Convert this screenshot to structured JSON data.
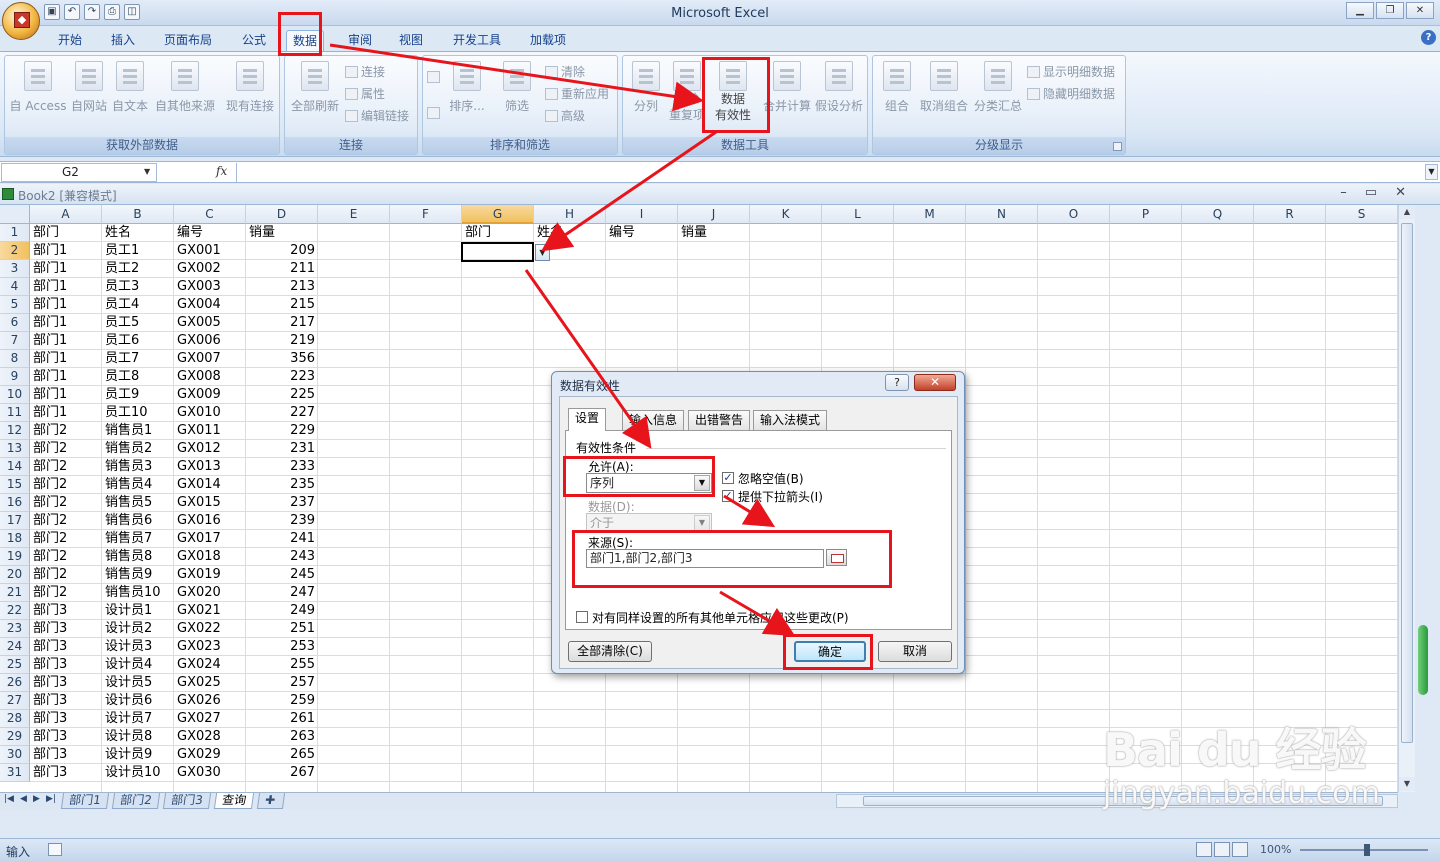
{
  "app": {
    "title": "Microsoft Excel"
  },
  "ribbon_tabs": [
    "开始",
    "插入",
    "页面布局",
    "公式",
    "数据",
    "审阅",
    "视图",
    "开发工具",
    "加载项"
  ],
  "active_tab": "数据",
  "ribbon": {
    "get_external": {
      "label": "获取外部数据",
      "buttons": [
        "自 Access",
        "自网站",
        "自文本",
        "自其他来源",
        "现有连接"
      ]
    },
    "connections": {
      "label": "连接",
      "refresh_all": "全部刷新",
      "items": [
        "连接",
        "属性",
        "编辑链接"
      ]
    },
    "sort_filter": {
      "label": "排序和筛选",
      "sort": "排序...",
      "filter": "筛选",
      "items": [
        "清除",
        "重新应用",
        "高级"
      ]
    },
    "data_tools": {
      "label": "数据工具",
      "buttons": [
        "分列",
        "删除\n重复项",
        "数据\n有效性",
        "合并计算",
        "假设分析"
      ]
    },
    "outline": {
      "label": "分级显示",
      "buttons": [
        "组合",
        "取消组合",
        "分类汇总"
      ],
      "items": [
        "显示明细数据",
        "隐藏明细数据"
      ]
    }
  },
  "formula_bar": {
    "name_box": "G2",
    "fx": "fx",
    "value": ""
  },
  "workbook": {
    "title": "Book2  [兼容模式]"
  },
  "columns": [
    "A",
    "B",
    "C",
    "D",
    "E",
    "F",
    "G",
    "H",
    "I",
    "J",
    "K",
    "L",
    "M",
    "N",
    "O",
    "P",
    "Q",
    "R",
    "S"
  ],
  "header_row": [
    "部门",
    "姓名",
    "编号",
    "销量"
  ],
  "query_headers": [
    "部门",
    "姓名",
    "编号",
    "销量"
  ],
  "rows": [
    [
      "部门1",
      "员工1",
      "GX001",
      "209"
    ],
    [
      "部门1",
      "员工2",
      "GX002",
      "211"
    ],
    [
      "部门1",
      "员工3",
      "GX003",
      "213"
    ],
    [
      "部门1",
      "员工4",
      "GX004",
      "215"
    ],
    [
      "部门1",
      "员工5",
      "GX005",
      "217"
    ],
    [
      "部门1",
      "员工6",
      "GX006",
      "219"
    ],
    [
      "部门1",
      "员工7",
      "GX007",
      "356"
    ],
    [
      "部门1",
      "员工8",
      "GX008",
      "223"
    ],
    [
      "部门1",
      "员工9",
      "GX009",
      "225"
    ],
    [
      "部门1",
      "员工10",
      "GX010",
      "227"
    ],
    [
      "部门2",
      "销售员1",
      "GX011",
      "229"
    ],
    [
      "部门2",
      "销售员2",
      "GX012",
      "231"
    ],
    [
      "部门2",
      "销售员3",
      "GX013",
      "233"
    ],
    [
      "部门2",
      "销售员4",
      "GX014",
      "235"
    ],
    [
      "部门2",
      "销售员5",
      "GX015",
      "237"
    ],
    [
      "部门2",
      "销售员6",
      "GX016",
      "239"
    ],
    [
      "部门2",
      "销售员7",
      "GX017",
      "241"
    ],
    [
      "部门2",
      "销售员8",
      "GX018",
      "243"
    ],
    [
      "部门2",
      "销售员9",
      "GX019",
      "245"
    ],
    [
      "部门2",
      "销售员10",
      "GX020",
      "247"
    ],
    [
      "部门3",
      "设计员1",
      "GX021",
      "249"
    ],
    [
      "部门3",
      "设计员2",
      "GX022",
      "251"
    ],
    [
      "部门3",
      "设计员3",
      "GX023",
      "253"
    ],
    [
      "部门3",
      "设计员4",
      "GX024",
      "255"
    ],
    [
      "部门3",
      "设计员5",
      "GX025",
      "257"
    ],
    [
      "部门3",
      "设计员6",
      "GX026",
      "259"
    ],
    [
      "部门3",
      "设计员7",
      "GX027",
      "261"
    ],
    [
      "部门3",
      "设计员8",
      "GX028",
      "263"
    ],
    [
      "部门3",
      "设计员9",
      "GX029",
      "265"
    ],
    [
      "部门3",
      "设计员10",
      "GX030",
      "267"
    ]
  ],
  "sheet_tabs": [
    "部门1",
    "部门2",
    "部门3",
    "查询"
  ],
  "active_sheet": "查询",
  "status": {
    "mode": "输入",
    "zoom": "100%"
  },
  "dialog": {
    "title": "数据有效性",
    "help": "?",
    "close": "✕",
    "tabs": [
      "设置",
      "输入信息",
      "出错警告",
      "输入法模式"
    ],
    "section": "有效性条件",
    "allow_label": "允许(A):",
    "allow_value": "序列",
    "ignore_blank": "忽略空值(B)",
    "dropdown": "提供下拉箭头(I)",
    "data_label": "数据(D):",
    "data_value": "介于",
    "source_label": "来源(S):",
    "source_value": "部门1,部门2,部门3",
    "apply_all": "对有同样设置的所有其他单元格应用这些更改(P)",
    "clear_all": "全部清除(C)",
    "ok": "确定",
    "cancel": "取消"
  },
  "watermark": {
    "logo": "Bai du 经验",
    "url": "jingyan.baidu.com"
  }
}
